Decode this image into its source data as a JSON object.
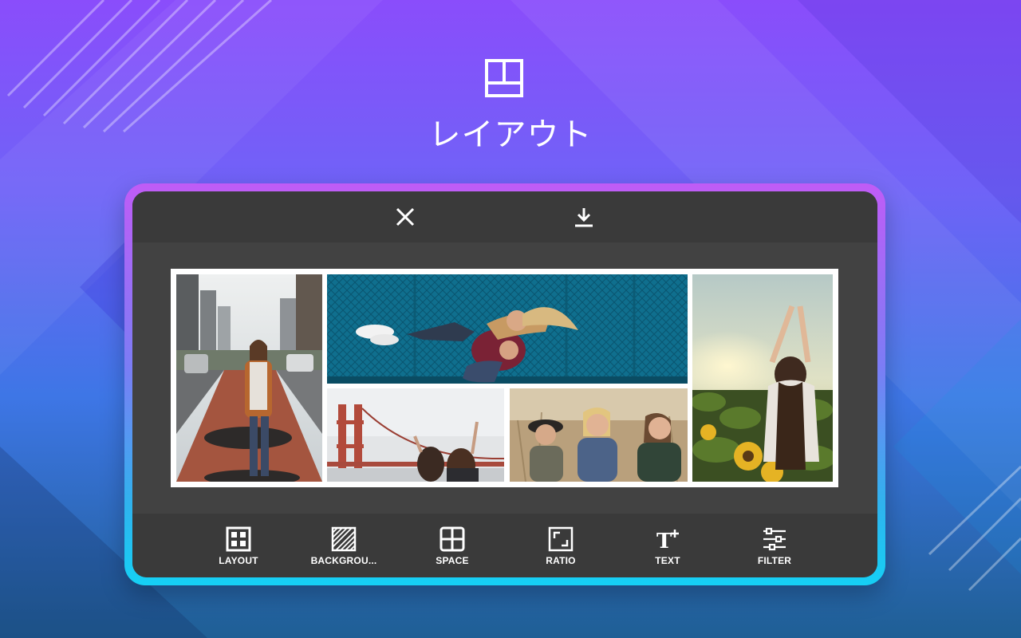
{
  "hero": {
    "icon": "layout-panels-icon",
    "title": "レイアウト"
  },
  "editor": {
    "topbar": {
      "close_icon": "close-icon",
      "download_icon": "download-icon"
    },
    "collage": {
      "photos": [
        "woman-on-city-street-photo",
        "couple-piggyback-photo",
        "friends-at-golden-gate-bridge-photo",
        "three-smiling-girls-photo",
        "woman-in-sunflower-field-photo"
      ]
    },
    "toolbar": {
      "items": [
        {
          "label": "LAYOUT",
          "icon": "layout-grid-icon"
        },
        {
          "label": "BACKGROU...",
          "icon": "background-pattern-icon"
        },
        {
          "label": "SPACE",
          "icon": "space-grid-icon"
        },
        {
          "label": "RATIO",
          "icon": "ratio-crop-icon"
        },
        {
          "label": "TEXT",
          "icon": "text-add-icon"
        },
        {
          "label": "FILTER",
          "icon": "filter-sliders-icon"
        }
      ]
    }
  },
  "colors": {
    "background_top": "#8a4dfb",
    "background_bottom": "#1f5f95",
    "frame_top": "#c05cf6",
    "frame_bottom": "#15d0f5",
    "screen": "#424242",
    "bars": "#3a3a3a"
  }
}
